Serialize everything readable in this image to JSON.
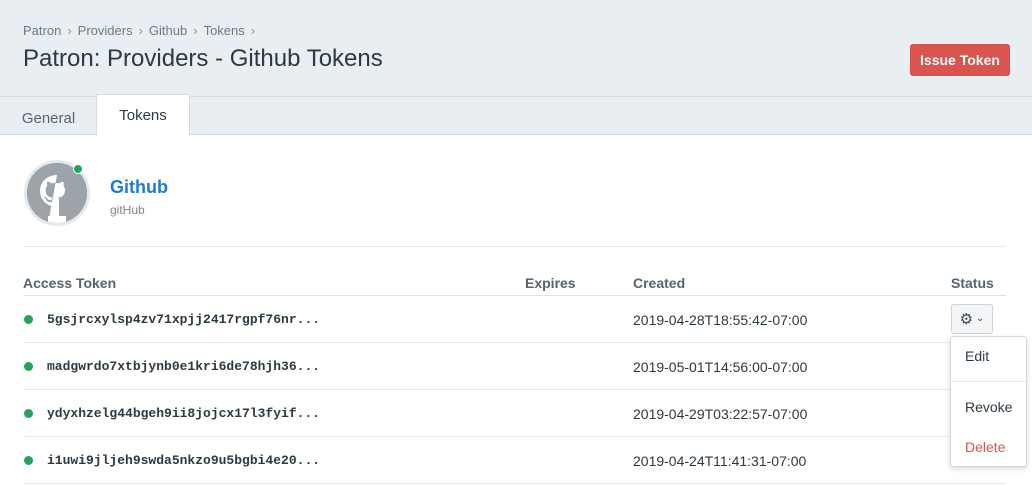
{
  "breadcrumb": [
    "Patron",
    "Providers",
    "Github",
    "Tokens"
  ],
  "page_title": "Patron: Providers - Github Tokens",
  "issue_button": "Issue Token",
  "tabs": [
    {
      "label": "General",
      "active": false
    },
    {
      "label": "Tokens",
      "active": true
    }
  ],
  "provider": {
    "name": "Github",
    "subtitle": "gitHub",
    "status": "active",
    "avatar_icon": "github-octocat-icon"
  },
  "table": {
    "columns": [
      "Access Token",
      "Expires",
      "Created",
      "Status"
    ],
    "rows": [
      {
        "token": "5gsjrcxylsp4zv71xpjj2417rgpf76nr...",
        "expires": "",
        "created": "2019-04-28T18:55:42-07:00",
        "active": true
      },
      {
        "token": "madgwrdo7xtbjynb0e1kri6de78hjh36...",
        "expires": "",
        "created": "2019-05-01T14:56:00-07:00",
        "active": true
      },
      {
        "token": "ydyxhzelg44bgeh9ii8jojcx17l3fyif...",
        "expires": "",
        "created": "2019-04-29T03:22:57-07:00",
        "active": true
      },
      {
        "token": "i1uwi9jljeh9swda5nkzo9u5bgbi4e20...",
        "expires": "",
        "created": "2019-04-24T11:41:31-07:00",
        "active": true
      }
    ]
  },
  "actions_menu": {
    "trigger_icon": "gear-icon",
    "items": [
      "Edit",
      "Revoke",
      "Delete"
    ]
  },
  "colors": {
    "accent": "#1e7ad6",
    "danger": "#d9534f",
    "success": "#21a55a",
    "header_bg": "#e9eef3"
  }
}
